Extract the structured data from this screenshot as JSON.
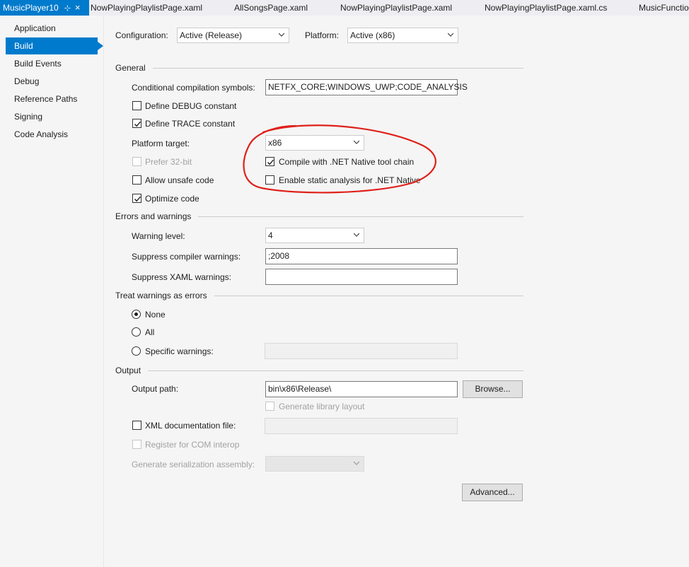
{
  "tabs": [
    {
      "label": "MusicPlayer10",
      "active": true
    },
    {
      "label": "NowPlayingPlaylistPage.xaml"
    },
    {
      "label": "AllSongsPage.xaml"
    },
    {
      "label": "NowPlayingPlaylistPage.xaml"
    },
    {
      "label": "NowPlayingPlaylistPage.xaml.cs"
    },
    {
      "label": "MusicFunctio"
    }
  ],
  "tab_pin_glyph": "⊹",
  "tab_close_glyph": "×",
  "nav": {
    "items": [
      "Application",
      "Build",
      "Build Events",
      "Debug",
      "Reference Paths",
      "Signing",
      "Code Analysis"
    ],
    "selected": "Build"
  },
  "header": {
    "configuration_label": "Configuration:",
    "configuration_value": "Active (Release)",
    "platform_label": "Platform:",
    "platform_value": "Active (x86)"
  },
  "general": {
    "title": "General",
    "cond_symbols_label": "Conditional compilation symbols:",
    "cond_symbols_value": "NETFX_CORE;WINDOWS_UWP;CODE_ANALYSIS",
    "define_debug_label": "Define DEBUG constant",
    "define_debug": false,
    "define_trace_label": "Define TRACE constant",
    "define_trace": true,
    "platform_target_label": "Platform target:",
    "platform_target_value": "x86",
    "prefer32_label": "Prefer 32-bit",
    "prefer32": false,
    "compile_native_label": "Compile with .NET Native tool chain",
    "compile_native": true,
    "unsafe_label": "Allow unsafe code",
    "unsafe": false,
    "static_analysis_label": "Enable static analysis for .NET Native",
    "static_analysis": false,
    "optimize_label": "Optimize code",
    "optimize": true
  },
  "errors": {
    "title": "Errors and warnings",
    "warning_level_label": "Warning level:",
    "warning_level_value": "4",
    "suppress_compiler_label": "Suppress compiler warnings:",
    "suppress_compiler_value": ";2008",
    "suppress_xaml_label": "Suppress XAML warnings:",
    "suppress_xaml_value": ""
  },
  "treat": {
    "title": "Treat warnings as errors",
    "none_label": "None",
    "all_label": "All",
    "specific_label": "Specific warnings:",
    "selected": "None",
    "specific_value": ""
  },
  "output": {
    "title": "Output",
    "path_label": "Output path:",
    "path_value": "bin\\x86\\Release\\",
    "browse_label": "Browse...",
    "gen_lib_layout_label": "Generate library layout",
    "xml_doc_label": "XML documentation file:",
    "xml_doc_value": "",
    "register_com_label": "Register for COM interop",
    "gen_serialization_label": "Generate serialization assembly:",
    "gen_serialization_value": "",
    "advanced_label": "Advanced..."
  },
  "colors": {
    "accent": "#007acc",
    "annotation": "#e0201a"
  }
}
